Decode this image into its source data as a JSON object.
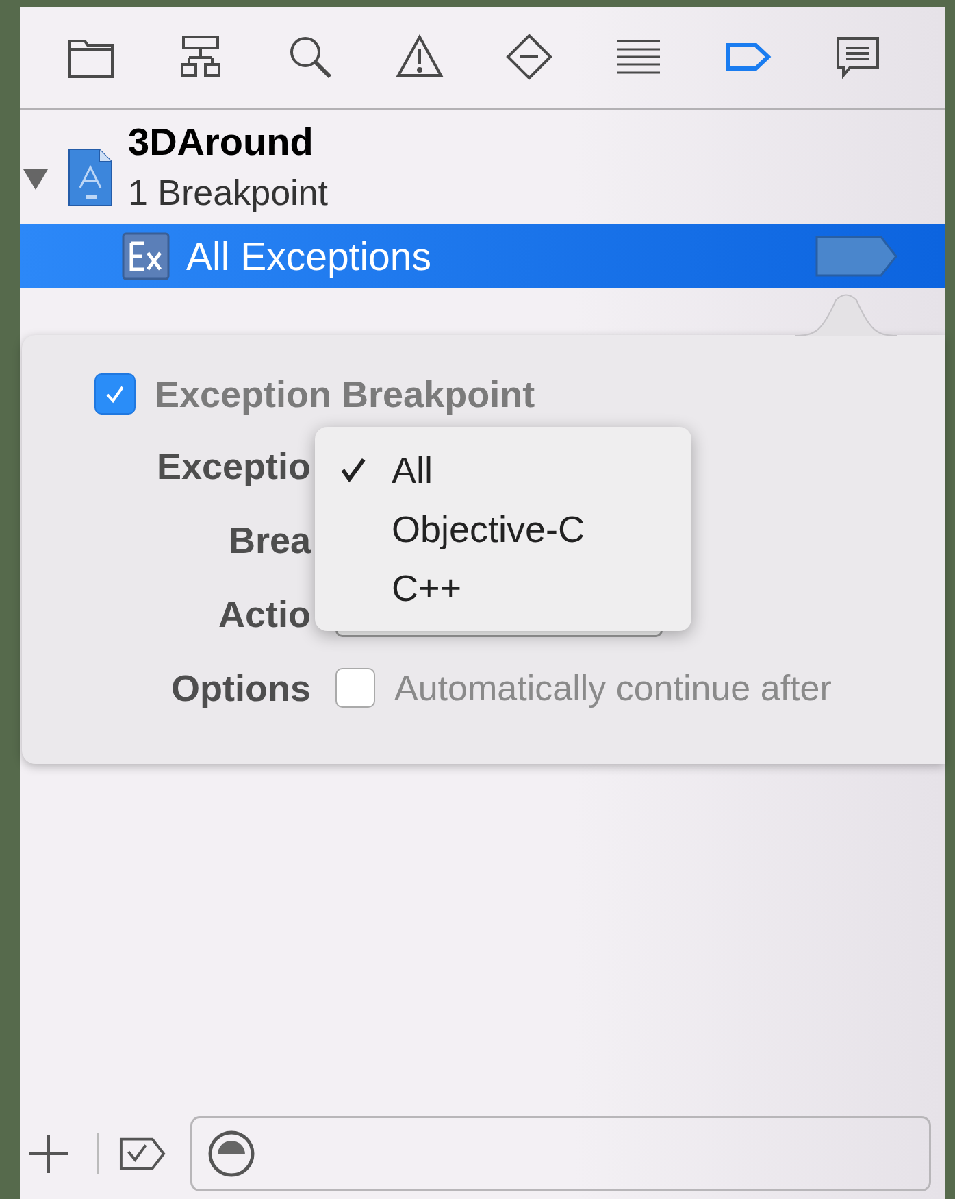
{
  "toolbar": [
    {
      "selected": false
    },
    {
      "selected": false
    },
    {
      "selected": false
    },
    {
      "selected": false
    },
    {
      "selected": false
    },
    {
      "selected": false
    },
    {
      "selected": true
    },
    {
      "selected": false
    }
  ],
  "tree": {
    "expanded": true,
    "project": {
      "name": "3DAround",
      "subtitle": "1 Breakpoint"
    },
    "breakpoints": [
      {
        "label": "All Exceptions",
        "selected": true,
        "enabled": true
      }
    ]
  },
  "popover": {
    "header": {
      "checked": true,
      "label": "Exception Breakpoint"
    },
    "rows": [
      {
        "kind": "label",
        "label": "Exceptio"
      },
      {
        "kind": "label",
        "label": "Brea"
      },
      {
        "kind": "button",
        "label": "Actio"
      },
      {
        "kind": "checkbox",
        "label": "Options",
        "checked": false,
        "text": "Automatically continue after"
      }
    ]
  },
  "menu": {
    "items": [
      {
        "label": "All",
        "selected": true
      },
      {
        "label": "Objective-C",
        "selected": false
      },
      {
        "label": "C++",
        "selected": false
      }
    ]
  }
}
